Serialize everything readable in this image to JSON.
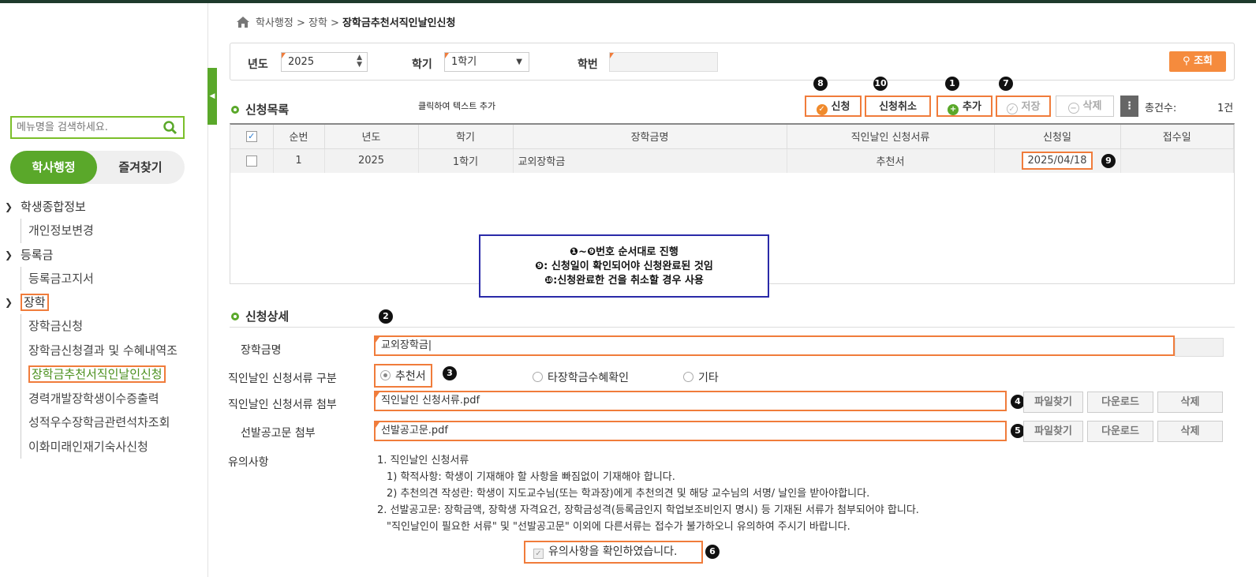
{
  "sidebar": {
    "search_placeholder": "메뉴명을 검색하세요.",
    "tab_active": "학사행정",
    "tab_other": "즐겨찾기",
    "groups": [
      {
        "label": "학생종합정보",
        "items": [
          "개인정보변경"
        ]
      },
      {
        "label": "등록금",
        "items": [
          "등록금고지서"
        ]
      },
      {
        "label": "장학",
        "items": [
          "장학금신청",
          "장학금신청결과 및 수혜내역조",
          "장학금추천서직인날인신청",
          "경력개발장학생이수증출력",
          "성적우수장학금관련석차조회",
          "이화미래인재기숙사신청"
        ]
      }
    ]
  },
  "breadcrumb": {
    "path": "학사행정 > 장학 >",
    "current": "장학금추천서직인날인신청"
  },
  "filter": {
    "year_label": "년도",
    "year_value": "2025",
    "term_label": "학기",
    "term_value": "1학기",
    "id_label": "학번",
    "query_button": "조회"
  },
  "list": {
    "title": "신청목록",
    "note": "클릭하여 텍스트 추가",
    "buttons": {
      "apply": "신청",
      "cancel": "신청취소",
      "add": "추가",
      "save": "저장",
      "delete": "삭제"
    },
    "total_label": "총건수:",
    "total_value": "1건",
    "columns": [
      "",
      "순번",
      "년도",
      "학기",
      "장학금명",
      "직인날인 신청서류",
      "신청일",
      "접수일"
    ],
    "rows": [
      {
        "seq": "1",
        "year": "2025",
        "term": "1학기",
        "name": "교외장학금",
        "doc": "추천서",
        "apply_date": "2025/04/18",
        "receipt_date": ""
      }
    ]
  },
  "markers": {
    "m1": "1",
    "m2": "2",
    "m3": "3",
    "m4": "4",
    "m5": "5",
    "m6": "6",
    "m7": "7",
    "m8": "8",
    "m9": "9",
    "m10": "10"
  },
  "guide": {
    "line1": "❶~❾번호 순서대로 진행",
    "line2": "❾: 신청일이 확인되어야 신청완료된 것임",
    "line3": "❿:신청완료한 건을 취소할 경우 사용"
  },
  "detail": {
    "title": "신청상세",
    "name_label": "장학금명",
    "name_value": "교외장학금|",
    "type_label": "직인날인 신청서류 구분",
    "type_options": [
      "추천서",
      "타장학금수혜확인",
      "기타"
    ],
    "attach_label": "직인날인 신청서류 첨부",
    "attach_value": "직인날인 신청서류.pdf",
    "notice_label": "선발공고문 첨부",
    "notice_value": "선발공고문.pdf",
    "find_button": "파일찾기",
    "download_button": "다운로드",
    "delete_button": "삭제",
    "caution_label": "유의사항",
    "caution_lines": [
      "1. 직인날인 신청서류",
      "1) 학적사항: 학생이 기재해야 할 사항을 빠짐없이 기재해야 합니다.",
      "2) 추천의견 작성란: 학생이 지도교수님(또는 학과장)에게 추천의견 및 해당 교수님의 서명/ 날인을 받아야합니다.",
      "2. 선발공고문: 장학금액, 장학생 자격요건, 장학금성격(등록금인지 학업보조비인지 명시) 등 기재된 서류가 첨부되어야 합니다.",
      "\"직인날인이 필요한 서류\" 및 \"선발공고문\" 이외에 다른서류는 접수가 불가하오니 유의하여 주시기 바랍니다."
    ],
    "confirm_label": "유의사항을 확인하였습니다."
  }
}
